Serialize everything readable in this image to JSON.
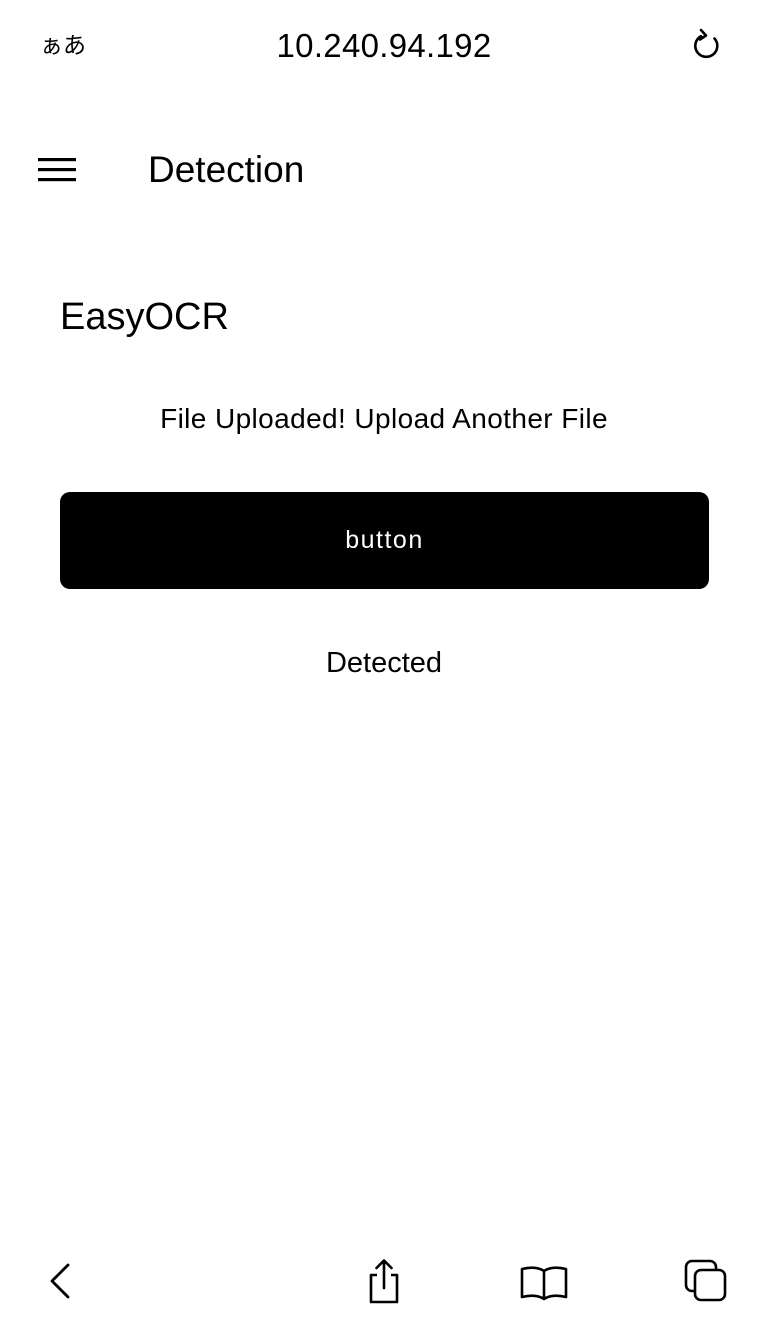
{
  "browser": {
    "aa_label": "ぁあ",
    "url": "10.240.94.192",
    "reload_icon": "reload-icon"
  },
  "header": {
    "menu_icon": "hamburger-menu-icon",
    "title": "Detection"
  },
  "main": {
    "heading": "EasyOCR",
    "upload_status": "File Uploaded! Upload Another File",
    "button_label": "button",
    "result": "Detected"
  },
  "toolbar": {
    "icons": [
      "back-chevron-icon",
      "share-icon",
      "bookmarks-icon",
      "tabs-icon"
    ]
  },
  "colors": {
    "button_bg": "#000000",
    "button_text": "#ffffff",
    "background": "#ffffff",
    "text": "#000000"
  }
}
